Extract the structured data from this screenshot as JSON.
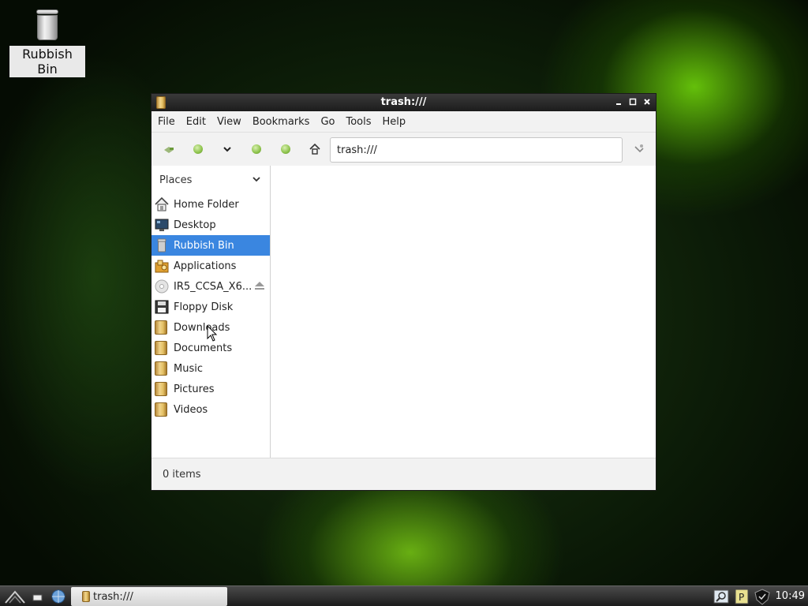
{
  "desktop": {
    "icons": [
      {
        "label": "Rubbish Bin",
        "icon": "trash-icon"
      }
    ]
  },
  "window": {
    "title": "trash:///",
    "menu": [
      "File",
      "Edit",
      "View",
      "Bookmarks",
      "Go",
      "Tools",
      "Help"
    ],
    "address": "trash:///",
    "sidebar": {
      "header": "Places",
      "items": [
        {
          "label": "Home Folder",
          "icon": "home-icon"
        },
        {
          "label": "Desktop",
          "icon": "desktop-icon"
        },
        {
          "label": "Rubbish Bin",
          "icon": "trash-icon",
          "active": true
        },
        {
          "label": "Applications",
          "icon": "applications-icon"
        },
        {
          "label": "IR5_CCSA_X6...",
          "icon": "optical-disc-icon",
          "ejectable": true
        },
        {
          "label": "Floppy Disk",
          "icon": "floppy-icon"
        },
        {
          "label": "Downloads",
          "icon": "folder-icon"
        },
        {
          "label": "Documents",
          "icon": "folder-icon"
        },
        {
          "label": "Music",
          "icon": "folder-icon"
        },
        {
          "label": "Pictures",
          "icon": "folder-icon"
        },
        {
          "label": "Videos",
          "icon": "folder-icon"
        }
      ]
    },
    "status": "0 items"
  },
  "taskbar": {
    "task": "trash:///",
    "clock": "10:49"
  },
  "colors": {
    "accent": "#3a86e0",
    "titlebar": "#2a2a2a"
  }
}
